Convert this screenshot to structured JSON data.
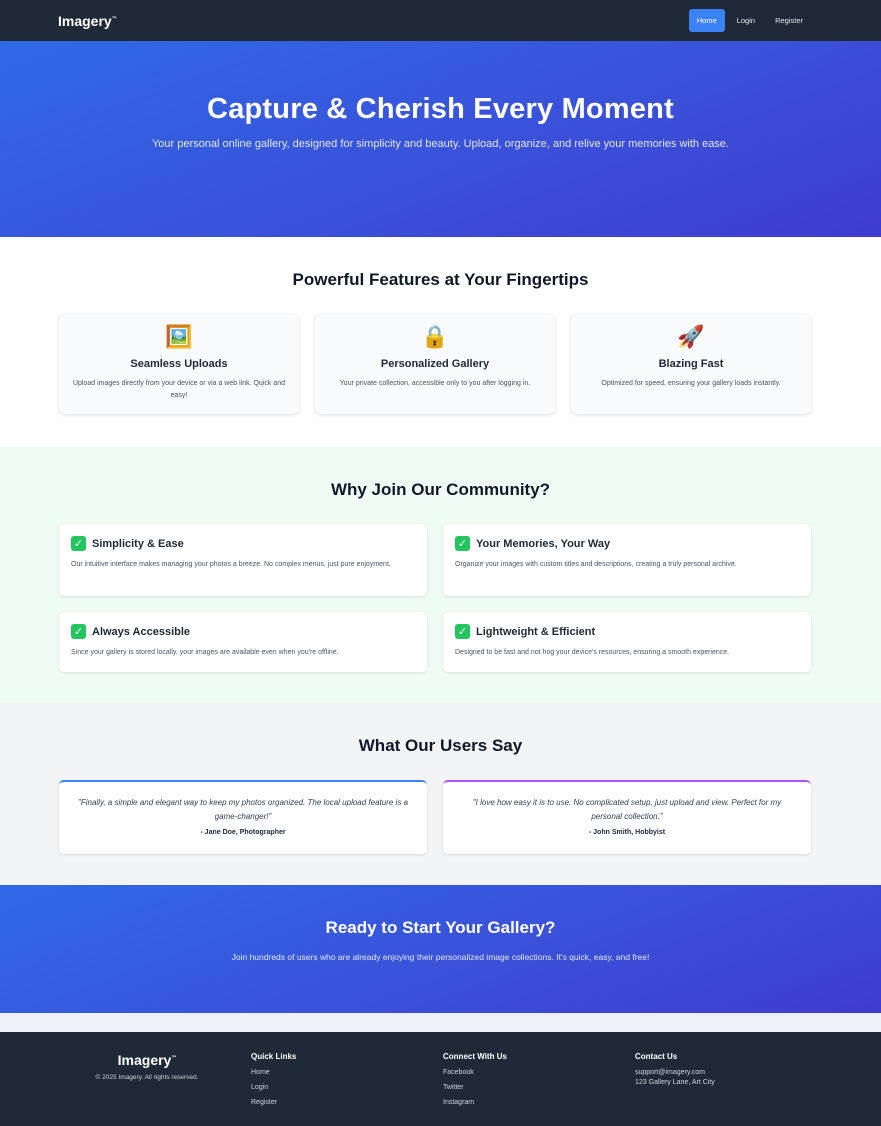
{
  "navbar": {
    "brand": "Imagery",
    "brand_tm": "™",
    "links": [
      {
        "label": "Home",
        "active": true
      },
      {
        "label": "Login",
        "active": false
      },
      {
        "label": "Register",
        "active": false
      }
    ]
  },
  "hero": {
    "title": "Capture & Cherish Every Moment",
    "subtitle": "Your personal online gallery, designed for simplicity and beauty. Upload, organize, and relive your memories with ease."
  },
  "features": {
    "title": "Powerful Features at Your Fingertips",
    "items": [
      {
        "icon": "🖼️",
        "icon_name": "framed-picture-icon",
        "title": "Seamless Uploads",
        "desc": "Upload images directly from your device or via a web link. Quick and easy!"
      },
      {
        "icon": "🔒",
        "icon_name": "lock-icon",
        "title": "Personalized Gallery",
        "desc": "Your private collection, accessible only to you after logging in."
      },
      {
        "icon": "🚀",
        "icon_name": "rocket-icon",
        "title": "Blazing Fast",
        "desc": "Optimized for speed, ensuring your gallery loads instantly."
      }
    ]
  },
  "why": {
    "title": "Why Join Our Community?",
    "items": [
      {
        "title": "Simplicity & Ease",
        "desc": "Our intuitive interface makes managing your photos a breeze. No complex menus, just pure enjoyment."
      },
      {
        "title": "Your Memories, Your Way",
        "desc": "Organize your images with custom titles and descriptions, creating a truly personal archive."
      },
      {
        "title": "Always Accessible",
        "desc": "Since your gallery is stored locally, your images are available even when you're offline."
      },
      {
        "title": "Lightweight & Efficient",
        "desc": "Designed to be fast and not hog your device's resources, ensuring a smooth experience."
      }
    ],
    "check_icon": "✓"
  },
  "testimonials": {
    "title": "What Our Users Say",
    "items": [
      {
        "quote": "\"Finally, a simple and elegant way to keep my photos organized. The local upload feature is a game-changer!\"",
        "author": "- Jane Doe, Photographer"
      },
      {
        "quote": "\"I love how easy it is to use. No complicated setup, just upload and view. Perfect for my personal collection.\"",
        "author": "- John Smith, Hobbyist"
      }
    ]
  },
  "cta": {
    "title": "Ready to Start Your Gallery?",
    "subtitle": "Join hundreds of users who are already enjoying their personalized image collections. It's quick, easy, and free!"
  },
  "footer": {
    "brand": "Imagery",
    "brand_tm": "™",
    "copyright": "© 2025 Imagery. All rights reserved.",
    "quick_links": {
      "title": "Quick Links",
      "items": [
        "Home",
        "Login",
        "Register"
      ]
    },
    "connect": {
      "title": "Connect With Us",
      "items": [
        "Facebook",
        "Twitter",
        "Instagram"
      ]
    },
    "contact": {
      "title": "Contact Us",
      "email": "support@imagery.com",
      "address": "123 Gallery Lane, Art City"
    }
  },
  "colors": {
    "accent": "#3b82f6",
    "navbar_bg": "#1f2937",
    "hero_gradient_start": "#2f6ae6",
    "hero_gradient_end": "#3e3bd0",
    "check_green": "#22c55e",
    "testimonial_blue": "#3b82f6",
    "testimonial_purple": "#a855f7"
  }
}
